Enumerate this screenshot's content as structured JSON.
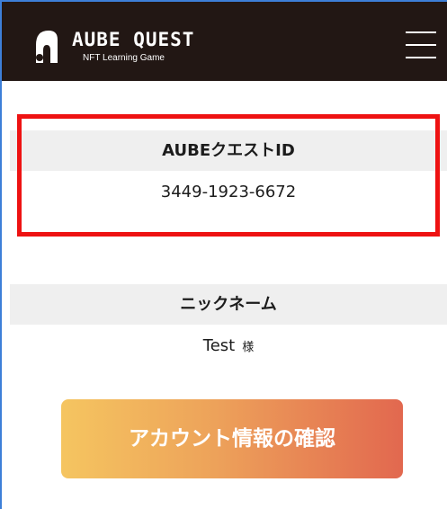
{
  "header": {
    "logo_title": "AUBE QUEST",
    "logo_subtitle": "NFT Learning Game",
    "background": "#221714"
  },
  "profile": {
    "id_label": "AUBEクエストID",
    "id_value": "3449-1923-6672",
    "nickname_label": "ニックネーム",
    "nickname_value": "Test",
    "honorific": "様"
  },
  "actions": {
    "account_button_label": "アカウント情報の確認"
  },
  "colors": {
    "highlight_border": "#ee1212",
    "button_gradient_start": "#f5c560",
    "button_gradient_end": "#e2684f",
    "section_label_bg": "#efefef"
  },
  "icons": {
    "logo": "aube-quest-logo-icon",
    "menu": "hamburger-menu-icon"
  }
}
